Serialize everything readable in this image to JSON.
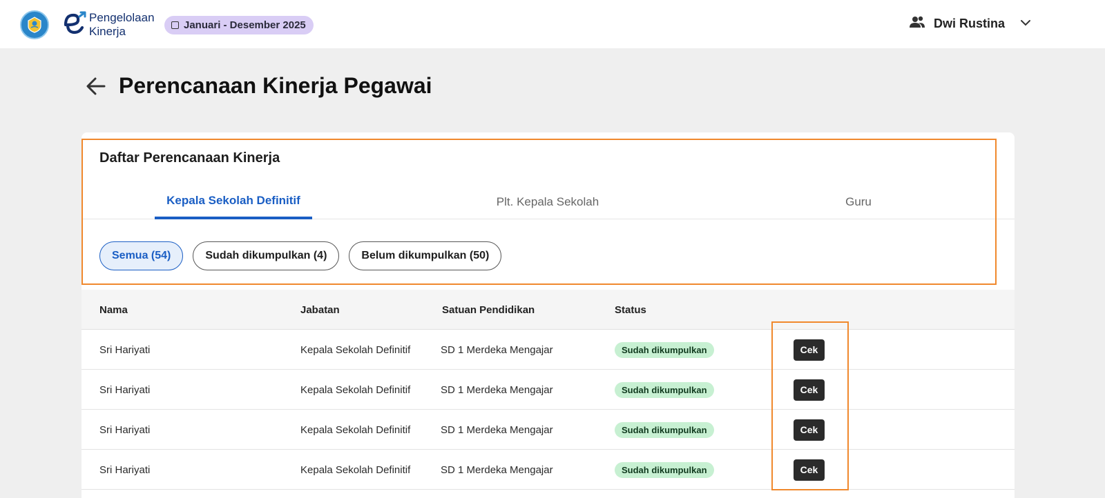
{
  "header": {
    "app_name_line1": "Pengelolaan",
    "app_name_line2": "Kinerja",
    "period": "Januari - Desember 2025",
    "user_name": "Dwi Rustina",
    "logo_icon": "tut-wuri-handayani-logo",
    "user_icon": "people-icon",
    "dropdown_icon": "chevron-down-icon"
  },
  "page": {
    "title": "Perencanaan Kinerja Pegawai",
    "back_icon": "arrow-left-icon"
  },
  "card": {
    "title": "Daftar Perencanaan Kinerja",
    "tabs": [
      {
        "label": "Kepala Sekolah Definitif",
        "active": true
      },
      {
        "label": "Plt. Kepala Sekolah",
        "active": false
      },
      {
        "label": "Guru",
        "active": false
      }
    ],
    "filters": [
      {
        "label": "Semua (54)",
        "active": true
      },
      {
        "label": "Sudah dikumpulkan (4)",
        "active": false
      },
      {
        "label": "Belum dikumpulkan (50)",
        "active": false
      }
    ]
  },
  "table": {
    "columns": [
      "Nama",
      "Jabatan",
      "Satuan Pendidikan",
      "Status"
    ],
    "rows": [
      {
        "nama": "Sri Hariyati",
        "jabatan": "Kepala Sekolah Definitif",
        "satuan": "SD 1 Merdeka Mengajar",
        "status": "Sudah dikumpulkan",
        "action": "Cek"
      },
      {
        "nama": "Sri Hariyati",
        "jabatan": "Kepala Sekolah Definitif",
        "satuan": "SD 1 Merdeka Mengajar",
        "status": "Sudah dikumpulkan",
        "action": "Cek"
      },
      {
        "nama": "Sri Hariyati",
        "jabatan": "Kepala Sekolah Definitif",
        "satuan": "SD 1 Merdeka Mengajar",
        "status": "Sudah dikumpulkan",
        "action": "Cek"
      },
      {
        "nama": "Sri Hariyati",
        "jabatan": "Kepala Sekolah Definitif",
        "satuan": "SD 1 Merdeka Mengajar",
        "status": "Sudah dikumpulkan",
        "action": "Cek"
      }
    ]
  },
  "colors": {
    "accent": "#1a5ec4",
    "highlight": "#f0882c",
    "status_bg": "#c7f0d2",
    "period_chip": "#d9cdf5"
  }
}
